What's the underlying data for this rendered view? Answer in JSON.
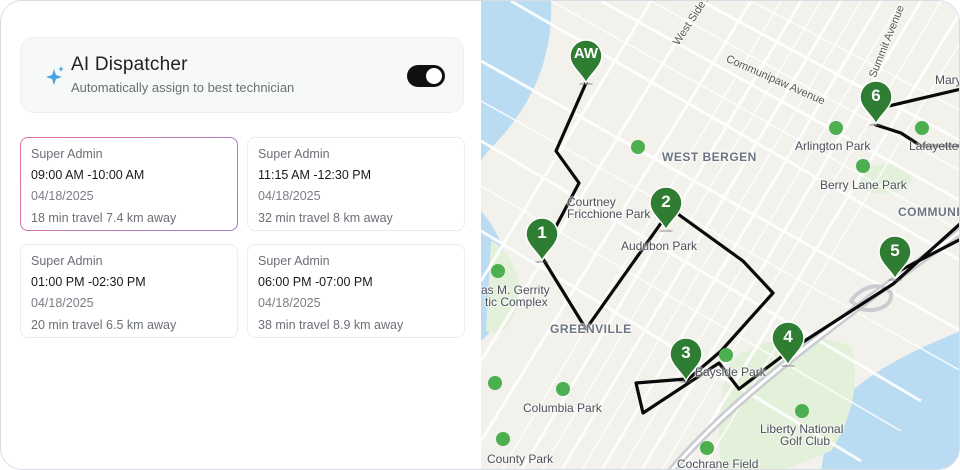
{
  "dispatcher": {
    "title": "AI Dispatcher",
    "subtitle": "Automatically assign to best technician",
    "enabled": true
  },
  "cards": [
    {
      "role": "Super Admin",
      "time": "09:00 AM -10:00 AM",
      "date": "04/18/2025",
      "meta": "18 min travel 7.4 km away",
      "selected": true
    },
    {
      "role": "Super Admin",
      "time": "11:15 AM -12:30 PM",
      "date": "04/18/2025",
      "meta": "32 min travel 8 km away",
      "selected": false
    },
    {
      "role": "Super Admin",
      "time": "01:00 PM -02:30 PM",
      "date": "04/18/2025",
      "meta": "20 min travel 6.5 km away",
      "selected": false
    },
    {
      "role": "Super Admin",
      "time": "06:00 PM -07:00 PM",
      "date": "04/18/2025",
      "meta": "38 min travel 8.9 km away",
      "selected": false
    }
  ],
  "map": {
    "pins": [
      {
        "label": "AW"
      },
      {
        "label": "1"
      },
      {
        "label": "2"
      },
      {
        "label": "3"
      },
      {
        "label": "4"
      },
      {
        "label": "5"
      },
      {
        "label": "6"
      }
    ],
    "places": {
      "west_bergen": "WEST BERGEN",
      "greenville": "GREENVILLE",
      "communi": "COMMUNI",
      "arlington_park": "Arlington Park",
      "lafayette_park": "Lafayette Park",
      "berry_lane_park": "Berry Lane Park",
      "courtney_line1": "Courtney",
      "courtney_line2": "Fricchione Park",
      "audubon_park": "Audubon Park",
      "gerrity_line1": "as M. Gerrity",
      "gerrity_line2": "tic Complex",
      "columbia_park": "Columbia Park",
      "bayside_park": "Bayside Park",
      "liberty_line1": "Liberty National",
      "liberty_line2": "Golf Club",
      "county_park": "County Park",
      "cochrane_field": "Cochrane Field",
      "mary": "Mary"
    },
    "streets": {
      "west_side_avenue": "West Side Avenue",
      "communipaw_avenue": "Communipaw Avenue",
      "summit_avenue": "Summit Avenue"
    },
    "colors": {
      "route": "#0a0a0a",
      "pin": "#2e7d32",
      "water": "#b9dcf2",
      "land": "#f3f1ec",
      "park": "#e3f0da"
    }
  }
}
